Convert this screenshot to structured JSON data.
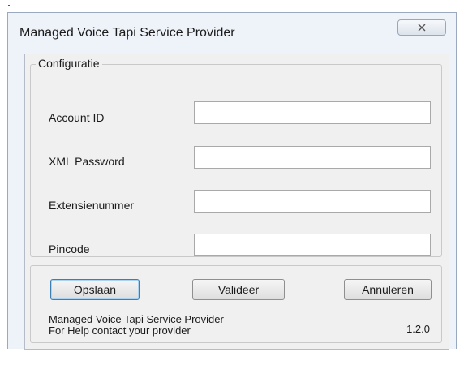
{
  "window": {
    "title": "Managed Voice Tapi Service Provider",
    "close_icon": "close-x-icon"
  },
  "config_group": {
    "legend": "Configuratie",
    "fields": [
      {
        "label": "Account ID",
        "value": "",
        "placeholder": ""
      },
      {
        "label": "XML Password",
        "value": "",
        "placeholder": ""
      },
      {
        "label": "Extensienummer",
        "value": "",
        "placeholder": ""
      },
      {
        "label": "Pincode",
        "value": "",
        "placeholder": ""
      }
    ]
  },
  "buttons": {
    "save": "Opslaan",
    "validate": "Valideer",
    "cancel": "Annuleren"
  },
  "footer": {
    "line1": "Managed Voice Tapi Service Provider",
    "line2": "For Help contact your provider",
    "version": "1.2.0"
  }
}
